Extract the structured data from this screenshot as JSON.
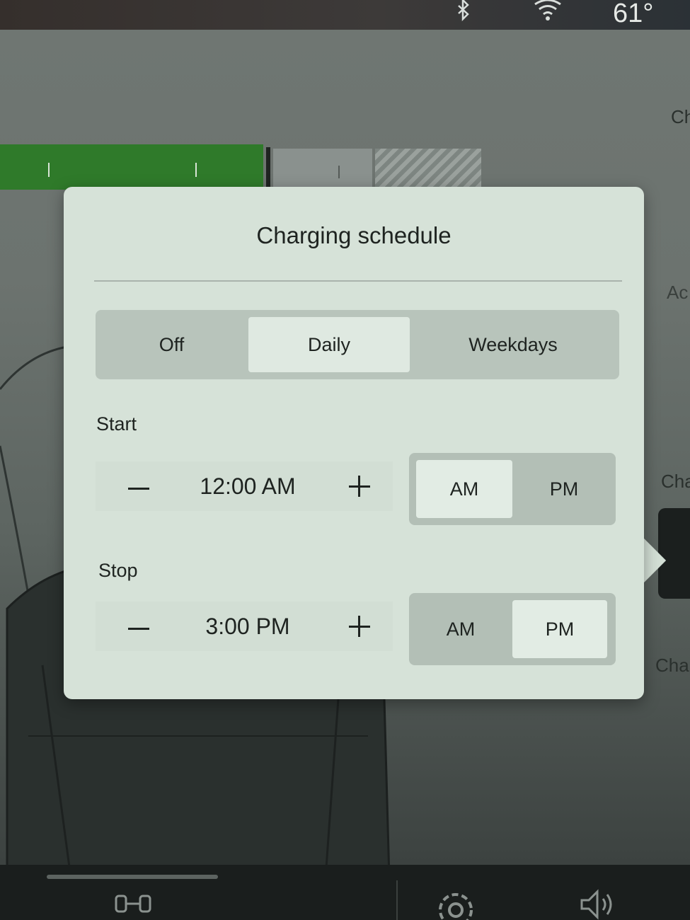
{
  "status_bar": {
    "temperature": "61°",
    "icons": [
      "bluetooth-icon",
      "wifi-icon"
    ]
  },
  "background": {
    "right_labels": [
      "Ch",
      "Ac",
      "Cha",
      "Cha"
    ]
  },
  "modal": {
    "title": "Charging schedule",
    "frequency": {
      "options": [
        "Off",
        "Daily",
        "Weekdays"
      ],
      "selected": "Daily"
    },
    "start": {
      "label": "Start",
      "time": "12:00 AM",
      "am_label": "AM",
      "pm_label": "PM",
      "selected_period": "AM"
    },
    "stop": {
      "label": "Stop",
      "time": "3:00 PM",
      "am_label": "AM",
      "pm_label": "PM",
      "selected_period": "PM"
    }
  },
  "dock": {
    "icons": [
      "tire-icon",
      "settings-icon",
      "volume-icon"
    ]
  }
}
